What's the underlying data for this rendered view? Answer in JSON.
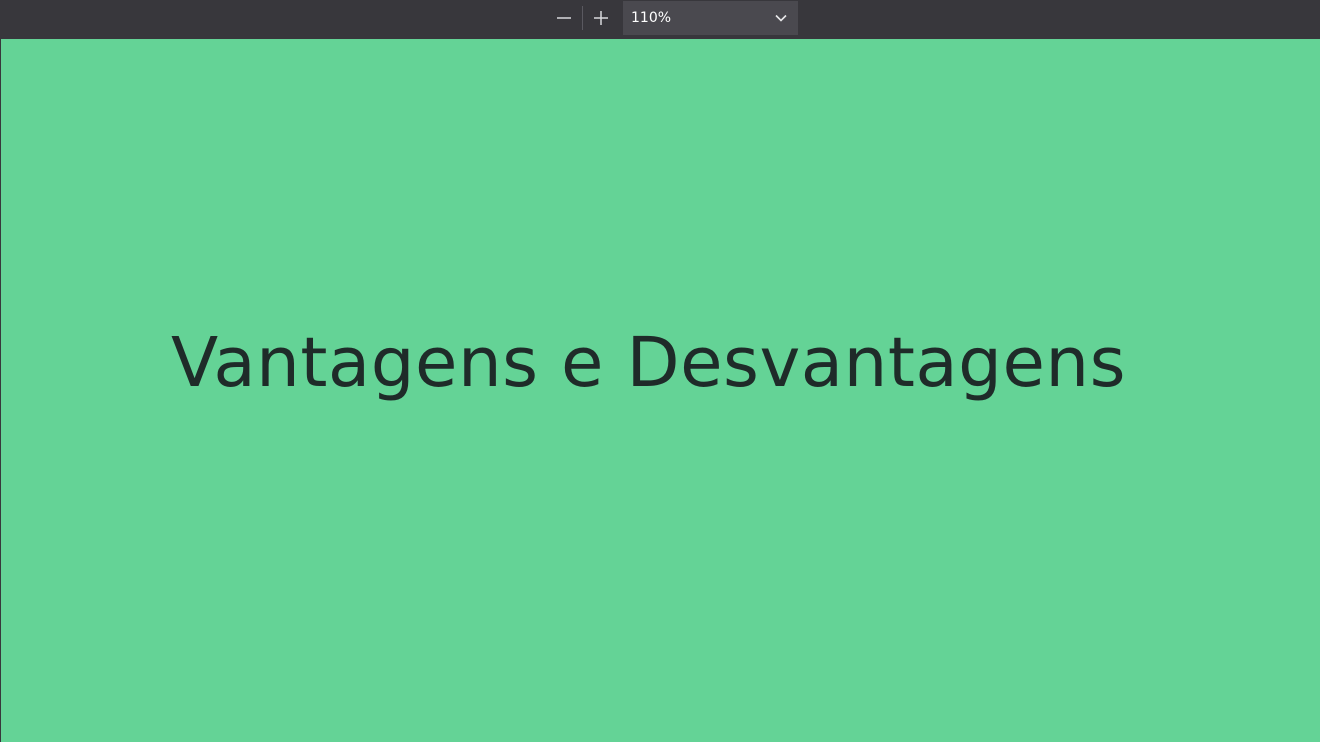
{
  "toolbar": {
    "zoom_out_icon": "minus-icon",
    "zoom_in_icon": "plus-icon",
    "zoom_value": "110%",
    "zoom_dropdown_icon": "chevron-down-icon"
  },
  "slide": {
    "title": "Vantagens e Desvantagens",
    "background_color": "#64d396",
    "text_color": "#1f2b29"
  },
  "colors": {
    "toolbar_bg": "#38373c",
    "select_bg": "#4a494f"
  }
}
